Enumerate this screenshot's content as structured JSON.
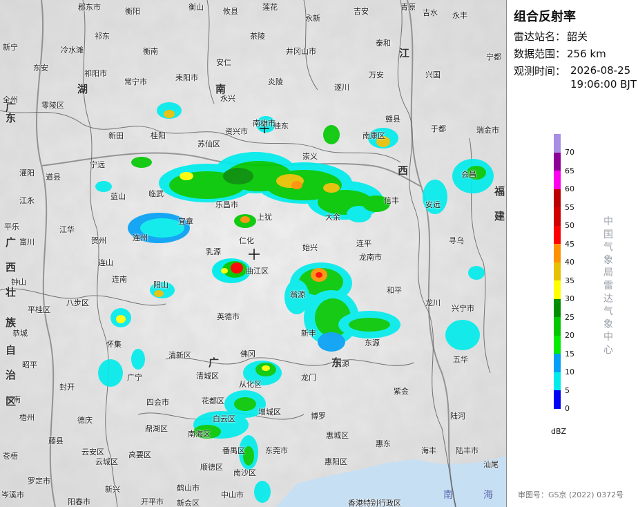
{
  "panel": {
    "title": "组合反射率",
    "station_label": "雷达站名：",
    "station_value": "韶关",
    "range_label": "数据范围：",
    "range_value": "256 km",
    "time_label": "观测时间：",
    "time_date": "2026-08-25",
    "time_clock": "19:06:00 BJT",
    "legend_unit": "dBZ",
    "agency": "中国气象局雷达气象中心",
    "approval": "审图号：GS京 (2022) 0372号"
  },
  "legend": [
    {
      "value": "70",
      "color": "#a98ee6"
    },
    {
      "value": "65",
      "color": "#8e0098"
    },
    {
      "value": "60",
      "color": "#ff00ef"
    },
    {
      "value": "55",
      "color": "#bc0000"
    },
    {
      "value": "50",
      "color": "#d10000"
    },
    {
      "value": "45",
      "color": "#ff0000"
    },
    {
      "value": "40",
      "color": "#ff9000"
    },
    {
      "value": "35",
      "color": "#e7c000"
    },
    {
      "value": "30",
      "color": "#ffff00"
    },
    {
      "value": "25",
      "color": "#008e00"
    },
    {
      "value": "20",
      "color": "#00c800"
    },
    {
      "value": "15",
      "color": "#00ec00"
    },
    {
      "value": "10",
      "color": "#01a0f6"
    },
    {
      "value": "5",
      "color": "#00ecec"
    },
    {
      "value": "0",
      "color": "#0000f6"
    }
  ],
  "places": [
    "郡东市",
    "衡阳",
    "衡山",
    "攸县",
    "莲花",
    "永新",
    "吉安",
    "青原",
    "吉水",
    "永丰",
    "新宁",
    "祁东",
    "茶陵",
    "泰和",
    "冷水滩",
    "祁阳市",
    "衡南",
    "安仁",
    "井冈山市",
    "宁都",
    "东安",
    "常宁市",
    "耒阳市",
    "炎陵",
    "万安",
    "兴国",
    "零陵区",
    "永兴",
    "遂川",
    "全州",
    "宁远",
    "资兴市",
    "桂东",
    "赣县",
    "瑞金市",
    "灌阳",
    "道县",
    "新田",
    "桂阳",
    "苏仙区",
    "崇义",
    "南康区",
    "于都",
    "江永",
    "蓝山",
    "临武",
    "宜章",
    "乐昌市",
    "上犹",
    "大余",
    "信丰",
    "安远",
    "会昌",
    "江华",
    "连州",
    "乳源",
    "曲江区",
    "仁化",
    "始兴",
    "南雄市",
    "龙南市",
    "寻乌",
    "连山",
    "连南",
    "阳山",
    "翁源",
    "和平",
    "龙川",
    "兴宁市",
    "八步区",
    "平桂区",
    "英德市",
    "新丰",
    "东源",
    "连平",
    "五华",
    "怀集",
    "广宁",
    "清新区",
    "清城区",
    "佛冈",
    "从化区",
    "龙门",
    "紫金",
    "河源",
    "封开",
    "四会市",
    "花都区",
    "白云区",
    "增城区",
    "博罗",
    "陆河",
    "德庆",
    "鼎湖区",
    "南海区",
    "番禺区",
    "惠城区",
    "惠东",
    "陆丰市",
    "云安区",
    "云城区",
    "高要区",
    "东莞市",
    "惠阳区",
    "海丰",
    "汕尾",
    "罗定市",
    "新兴",
    "鹤山市",
    "顺德区",
    "南沙区",
    "中山市",
    "阳春市",
    "开平市",
    "新会区",
    "香港特别行政区",
    "岑溪市",
    "郁南",
    "梧州",
    "苍梧",
    "藤县",
    "平乐",
    "钟山",
    "富川",
    "昭平",
    "恭城",
    "贺州"
  ],
  "provinces": [
    "湖",
    "南",
    "江",
    "西",
    "广",
    "西",
    "壮",
    "族",
    "自",
    "治",
    "区",
    "广",
    "东",
    "福",
    "建",
    "广",
    "东"
  ],
  "sea": [
    "南",
    "海"
  ]
}
